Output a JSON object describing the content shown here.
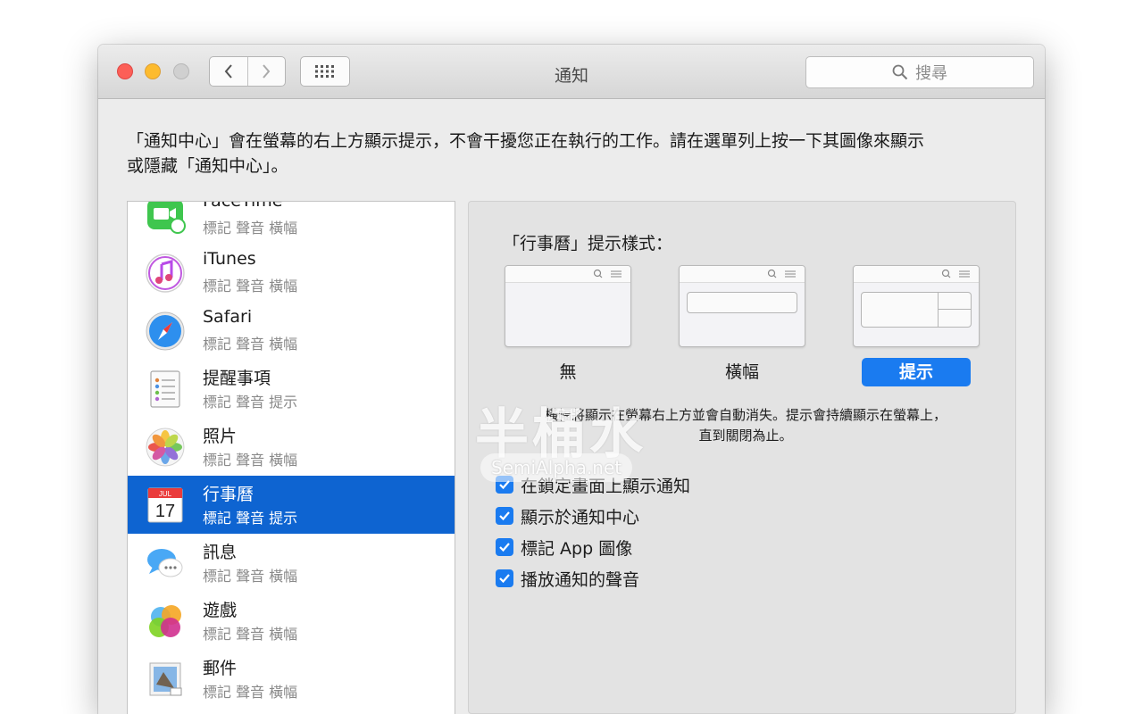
{
  "window": {
    "title": "通知",
    "search_placeholder": "搜尋"
  },
  "description": {
    "line1": "「通知中心」會在螢幕的右上方顯示提示，不會干擾您正在執行的工作。請在選單列上按一下其圖像來顯示",
    "line2": "或隱藏「通知中心」。"
  },
  "apps": [
    {
      "name": "FaceTime",
      "sub": "標記 聲音 橫幅",
      "icon": "facetime-icon"
    },
    {
      "name": "iTunes",
      "sub": "標記 聲音 橫幅",
      "icon": "itunes-icon"
    },
    {
      "name": "Safari",
      "sub": "標記 聲音 橫幅",
      "icon": "safari-icon"
    },
    {
      "name": "提醒事項",
      "sub": "標記 聲音 提示",
      "icon": "reminders-icon"
    },
    {
      "name": "照片",
      "sub": "標記 聲音 橫幅",
      "icon": "photos-icon"
    },
    {
      "name": "行事曆",
      "sub": "標記 聲音 提示",
      "icon": "calendar-icon",
      "calendar_month": "JUL",
      "calendar_day": "17"
    },
    {
      "name": "訊息",
      "sub": "標記 聲音 橫幅",
      "icon": "messages-icon"
    },
    {
      "name": "遊戲",
      "sub": "標記 聲音 橫幅",
      "icon": "game-center-icon"
    },
    {
      "name": "郵件",
      "sub": "標記 聲音 橫幅",
      "icon": "mail-icon"
    }
  ],
  "selected_app_index": 5,
  "alert_style": {
    "title": "「行事曆」提示樣式：",
    "options": [
      "無",
      "橫幅",
      "提示"
    ],
    "selected": "提示",
    "hint_line1": "橫幅將顯示在螢幕右上方並會自動消失。提示會持續顯示在螢幕上，",
    "hint_line2": "直到關閉為止。"
  },
  "checkboxes": [
    {
      "label": "在鎖定畫面上顯示通知",
      "checked": true
    },
    {
      "label": "顯示於通知中心",
      "checked": true
    },
    {
      "label": "標記 App 圖像",
      "checked": true
    },
    {
      "label": "播放通知的聲音",
      "checked": true
    }
  ],
  "watermark": {
    "text_cn": "半桶水",
    "text_url": "SemiAlpha.net"
  },
  "colors": {
    "selection": "#0e64d1",
    "accent": "#1a7bf0",
    "close": "#fc5f57",
    "minimize": "#fdbb2e"
  }
}
